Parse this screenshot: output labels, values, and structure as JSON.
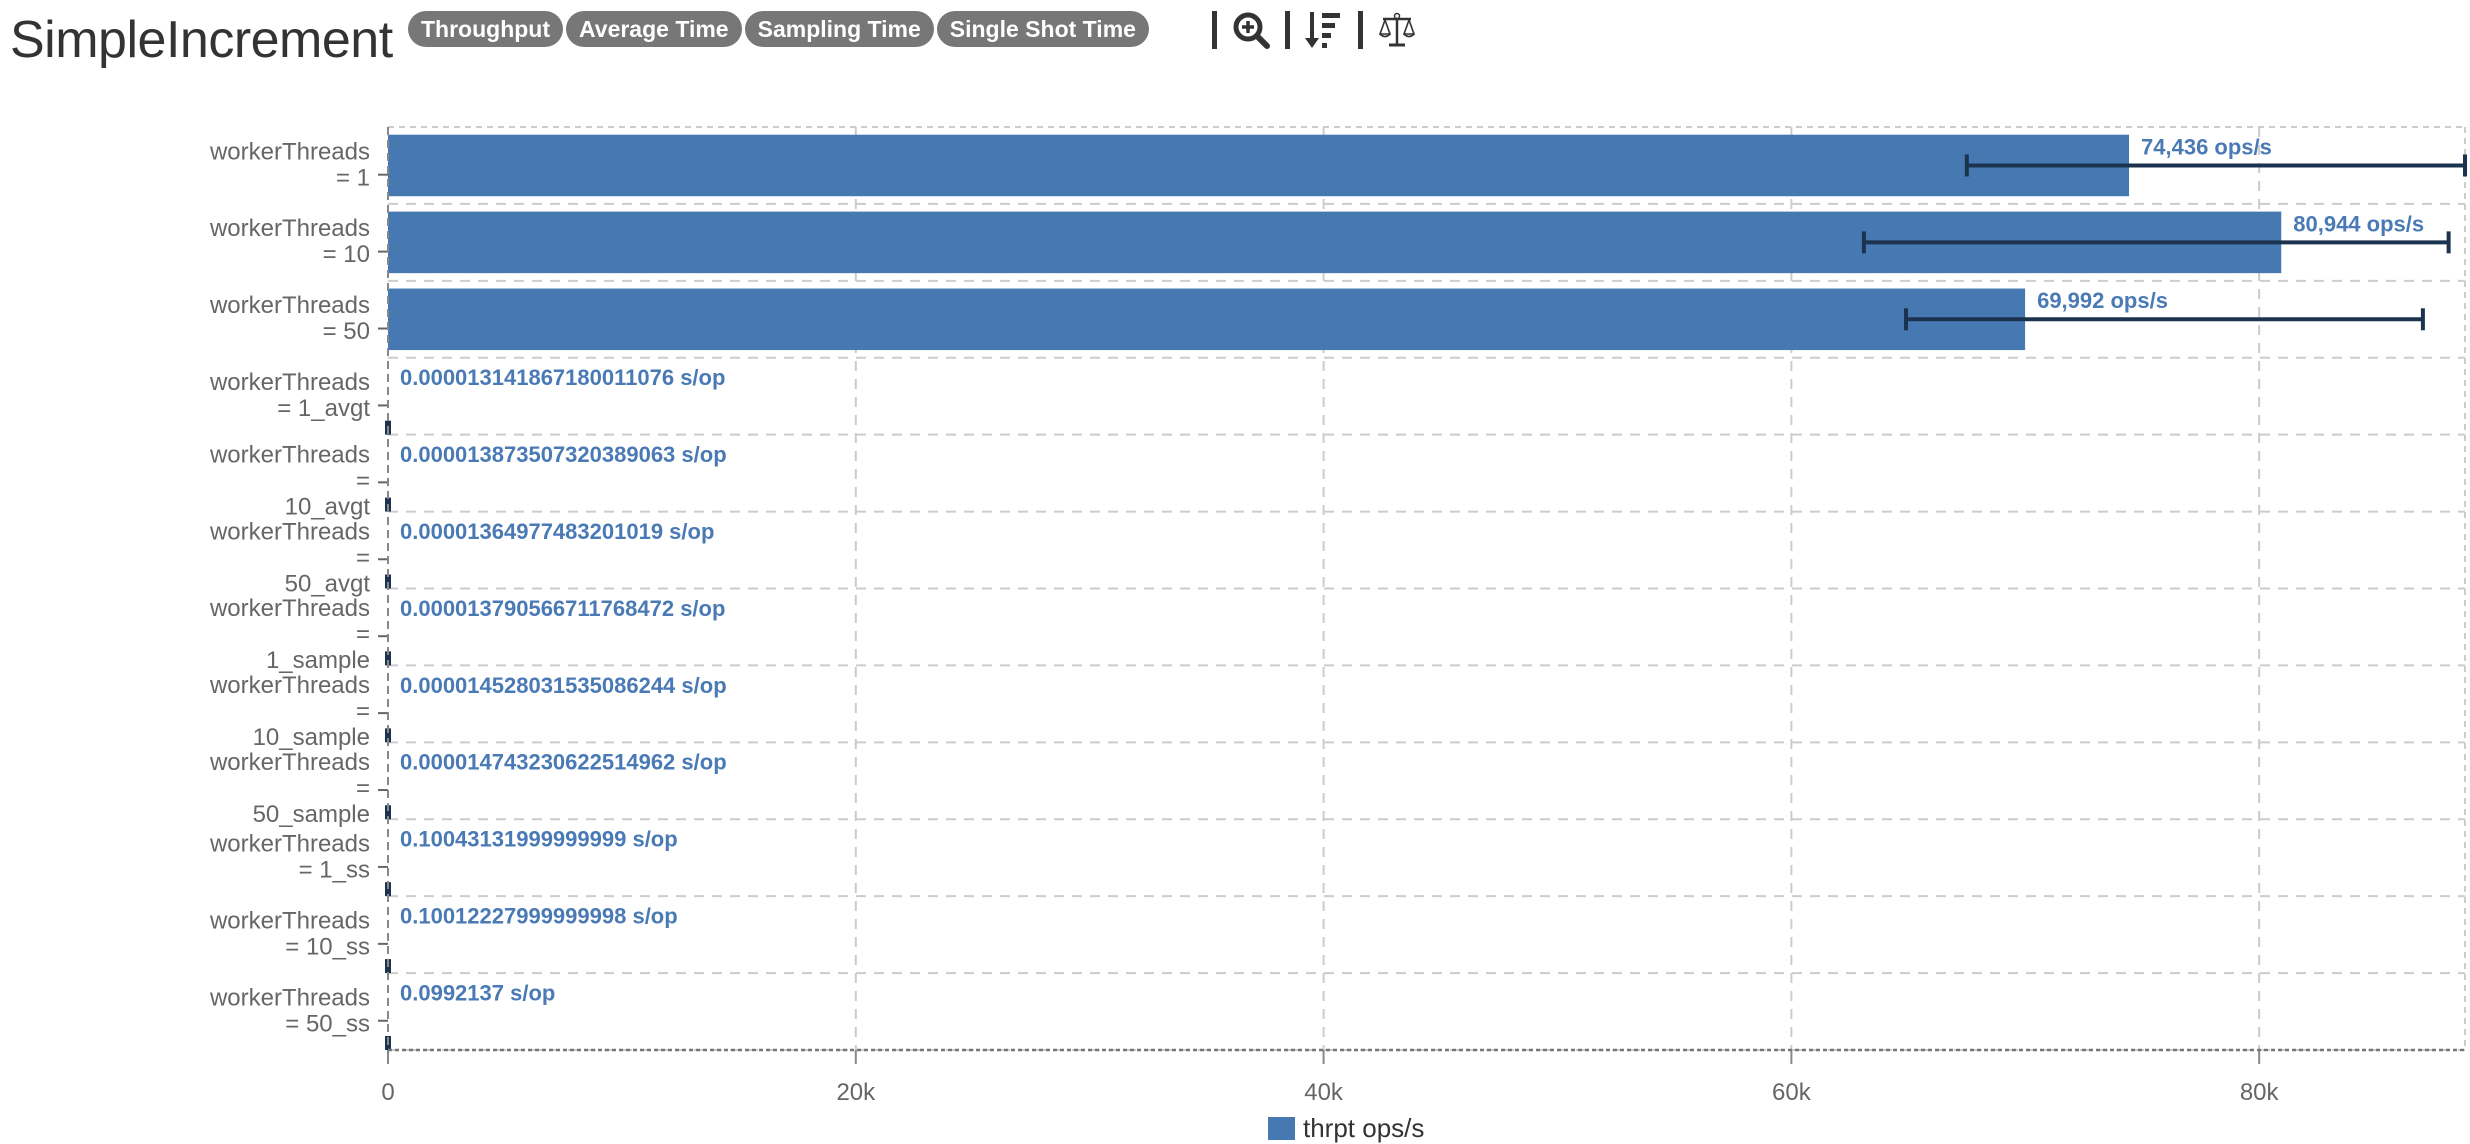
{
  "header": {
    "title": "SimpleIncrement",
    "modes": [
      "Throughput",
      "Average Time",
      "Sampling Time",
      "Single Shot Time"
    ],
    "tools": [
      {
        "icon": "zoom-in-icon"
      },
      {
        "icon": "sort-descending-icon"
      },
      {
        "icon": "balance-scale-icon"
      }
    ]
  },
  "colors": {
    "bar": "#4679b2",
    "error_bar": "#1c3350",
    "value_label": "#4a7ab5",
    "grid": "#cccccc",
    "axis_text": "#666666"
  },
  "chart_data": {
    "type": "bar",
    "orientation": "horizontal",
    "title": "SimpleIncrement",
    "xlabel": "",
    "ylabel": "",
    "xlim": [
      0,
      88800
    ],
    "x_ticks": [
      0,
      20000,
      40000,
      60000,
      80000
    ],
    "x_tick_labels": [
      "0",
      "20k",
      "40k",
      "60k",
      "80k"
    ],
    "grid": true,
    "legend": {
      "position": "bottom-center",
      "entries": [
        "thrpt ops/s"
      ]
    },
    "categories": [
      [
        "workerThreads",
        "= 1"
      ],
      [
        "workerThreads",
        "= 10"
      ],
      [
        "workerThreads",
        "= 50"
      ],
      [
        "workerThreads",
        "= 1_avgt"
      ],
      [
        "workerThreads",
        "=",
        "10_avgt"
      ],
      [
        "workerThreads",
        "=",
        "50_avgt"
      ],
      [
        "workerThreads",
        "=",
        "1_sample"
      ],
      [
        "workerThreads",
        "=",
        "10_sample"
      ],
      [
        "workerThreads",
        "=",
        "50_sample"
      ],
      [
        "workerThreads",
        "= 1_ss"
      ],
      [
        "workerThreads",
        "= 10_ss"
      ],
      [
        "workerThreads",
        "= 50_ss"
      ]
    ],
    "series": [
      {
        "name": "thrpt ops/s",
        "values": [
          74436,
          80944,
          69992,
          1.3141867180011076e-05,
          1.3873507320389063e-05,
          1.364977483201019e-05,
          1.3790566711768472e-05,
          1.4528031535086244e-05,
          1.4743230622514962e-05,
          0.10043131999999999,
          0.10012227999999998,
          0.0992137
        ],
        "error_low": [
          67500,
          63100,
          64900,
          null,
          null,
          null,
          null,
          null,
          null,
          null,
          null,
          null
        ],
        "error_high": [
          88800,
          88100,
          87000,
          null,
          null,
          null,
          null,
          null,
          null,
          null,
          null,
          null
        ],
        "labels": [
          "74,436 ops/s",
          "80,944 ops/s",
          "69,992 ops/s",
          "0.000013141867180011076 s/op",
          "0.000013873507320389063 s/op",
          "0.00001364977483201019 s/op",
          "0.000013790566711768472 s/op",
          "0.000014528031535086244 s/op",
          "0.000014743230622514962 s/op",
          "0.10043131999999999 s/op",
          "0.10012227999999998 s/op",
          "0.0992137 s/op"
        ]
      }
    ]
  }
}
